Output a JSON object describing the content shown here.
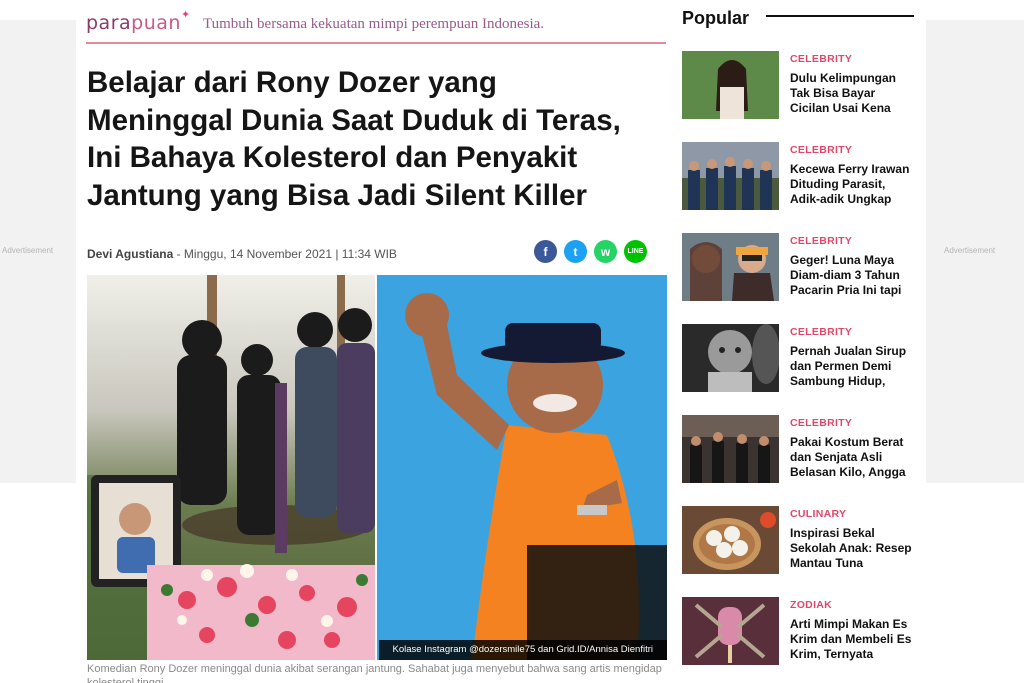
{
  "ads": {
    "left_label": "Advertisement",
    "right_label": "Advertisement"
  },
  "brand": {
    "logo_part1": "para",
    "logo_part2": "puan",
    "tagline": "Tumbuh bersama kekuatan mimpi perempuan Indonesia."
  },
  "article": {
    "headline_lines": [
      "Belajar dari Rony Dozer yang",
      "Meninggal Dunia Saat Duduk di Teras,",
      "Ini Bahaya Kolesterol dan Penyakit",
      "Jantung yang Bisa Jadi Silent Killer"
    ],
    "author": "Devi Agustiana",
    "datetime": " - Minggu, 14 November 2021 | 11:34 WIB",
    "share": {
      "facebook": "f",
      "twitter": "t",
      "whatsapp": "w",
      "line": "LINE"
    },
    "image_credit": "Kolase Instagram @dozersmile75 dan Grid.ID/Annisa Dienfitri",
    "caption": "Komedian Rony Dozer meninggal dunia akibat serangan jantung. Sahabat juga menyebut bahwa sang artis mengidap kolesterol tinggi."
  },
  "popular": {
    "title": "Popular",
    "items": [
      {
        "category": "CELEBRITY",
        "title": "Dulu Kelimpungan Tak Bisa Bayar Cicilan Usai Kena"
      },
      {
        "category": "CELEBRITY",
        "title": "Kecewa Ferry Irawan Dituding Parasit, Adik-adik Ungkap"
      },
      {
        "category": "CELEBRITY",
        "title": "Geger! Luna Maya Diam-diam 3 Tahun Pacarin Pria Ini tapi"
      },
      {
        "category": "CELEBRITY",
        "title": "Pernah Jualan Sirup dan Permen Demi Sambung Hidup,"
      },
      {
        "category": "CELEBRITY",
        "title": "Pakai Kostum Berat dan Senjata Asli Belasan Kilo, Angga"
      },
      {
        "category": "CULINARY",
        "title": "Inspirasi Bekal Sekolah Anak: Resep Mantau Tuna"
      },
      {
        "category": "ZODIAK",
        "title": "Arti Mimpi Makan Es Krim dan Membeli Es Krim, Ternyata"
      }
    ]
  }
}
